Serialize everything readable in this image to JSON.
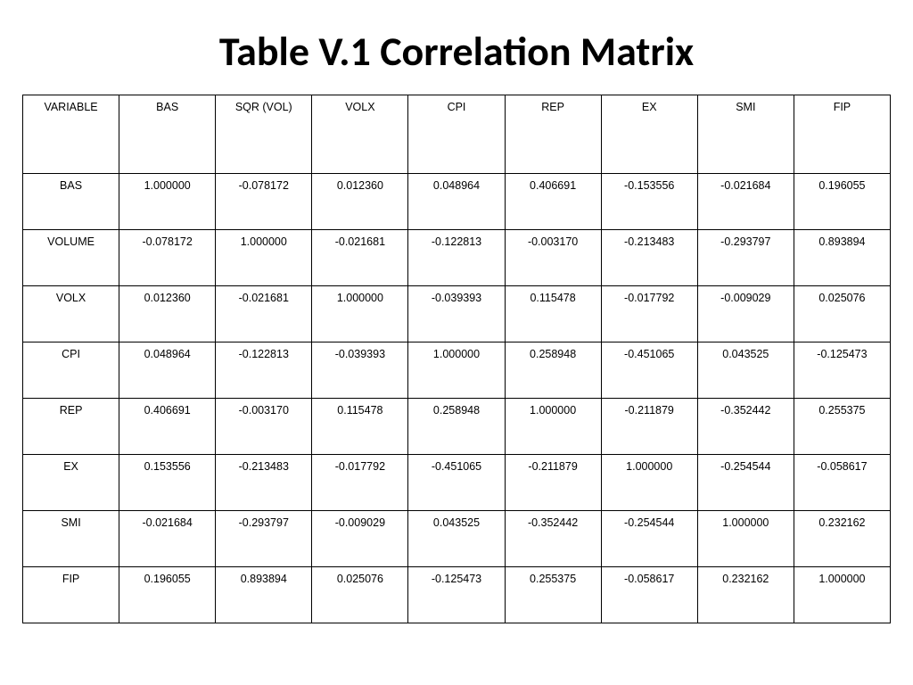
{
  "title": "Table V.1 Correlation Matrix",
  "chart_data": {
    "type": "table",
    "title": "Table V.1 Correlation Matrix",
    "columns": [
      "VARIABLE",
      "BAS",
      "SQR (VOL)",
      "VOLX",
      "CPI",
      "REP",
      "EX",
      "SMI",
      "FIP"
    ],
    "rows": [
      {
        "label": "BAS",
        "values": [
          "1.000000",
          "-0.078172",
          "0.012360",
          "0.048964",
          "0.406691",
          "-0.153556",
          "-0.021684",
          "0.196055"
        ]
      },
      {
        "label": "VOLUME",
        "values": [
          "-0.078172",
          "1.000000",
          "-0.021681",
          "-0.122813",
          "-0.003170",
          "-0.213483",
          "-0.293797",
          "0.893894"
        ]
      },
      {
        "label": "VOLX",
        "values": [
          "0.012360",
          "-0.021681",
          "1.000000",
          "-0.039393",
          "0.115478",
          "-0.017792",
          "-0.009029",
          "0.025076"
        ]
      },
      {
        "label": "CPI",
        "values": [
          "0.048964",
          "-0.122813",
          "-0.039393",
          "1.000000",
          "0.258948",
          "-0.451065",
          "0.043525",
          "-0.125473"
        ]
      },
      {
        "label": "REP",
        "values": [
          "0.406691",
          "-0.003170",
          "0.115478",
          "0.258948",
          "1.000000",
          "-0.211879",
          "-0.352442",
          "0.255375"
        ]
      },
      {
        "label": "EX",
        "values": [
          "0.153556",
          "-0.213483",
          "-0.017792",
          "-0.451065",
          "-0.211879",
          "1.000000",
          "-0.254544",
          "-0.058617"
        ]
      },
      {
        "label": "SMI",
        "values": [
          "-0.021684",
          "-0.293797",
          "-0.009029",
          "0.043525",
          "-0.352442",
          "-0.254544",
          "1.000000",
          "0.232162"
        ]
      },
      {
        "label": "FIP",
        "values": [
          "0.196055",
          "0.893894",
          "0.025076",
          "-0.125473",
          "0.255375",
          "-0.058617",
          "0.232162",
          "1.000000"
        ]
      }
    ]
  }
}
